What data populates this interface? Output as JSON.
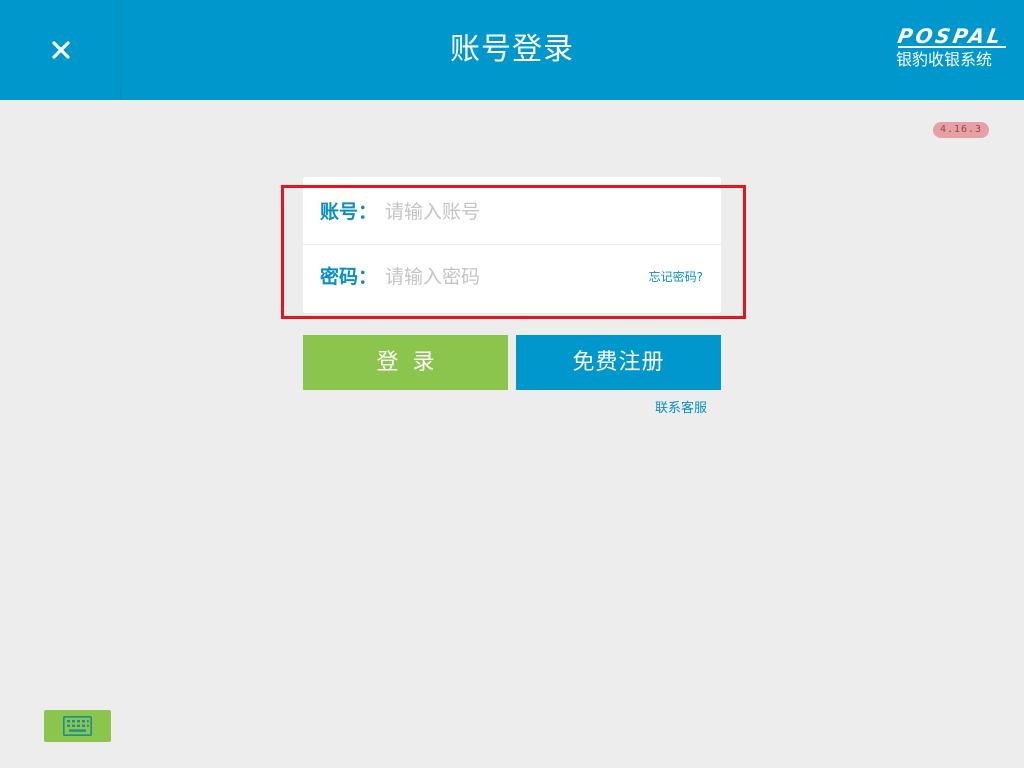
{
  "header": {
    "title": "账号登录",
    "close_icon": "close-icon",
    "logo_mark": "POSPAL",
    "logo_subtitle": "银豹收银系统"
  },
  "version": "4.16.3",
  "login_form": {
    "account_label": "账号：",
    "account_placeholder": "请输入账号",
    "account_value": "",
    "password_label": "密码：",
    "password_placeholder": "请输入密码",
    "password_value": "",
    "forgot_password": "忘记密码?"
  },
  "buttons": {
    "login": "登录",
    "register": "免费注册"
  },
  "support_link": "联系客服",
  "keyboard_icon": "keyboard-icon",
  "colors": {
    "header_bg": "#0098cc",
    "login_button": "#8bc54d",
    "register_button": "#0098cc",
    "highlight_border": "#e3151e",
    "label_text": "#0a8fc2"
  }
}
